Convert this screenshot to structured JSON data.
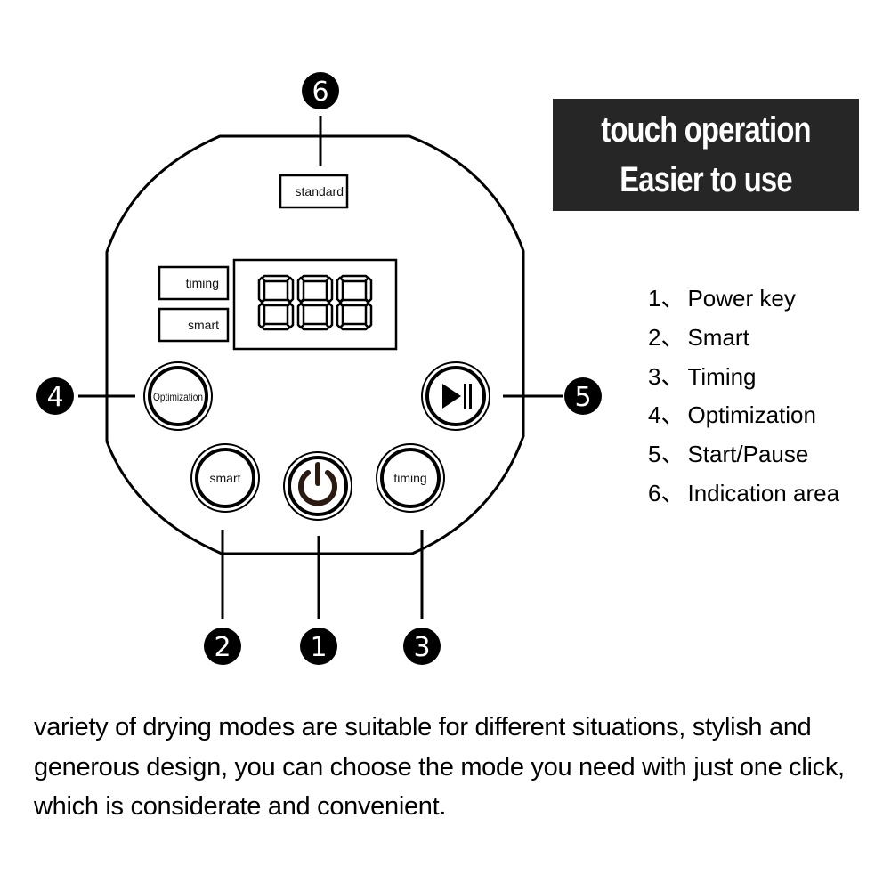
{
  "panel": {
    "indicator_standard": "standard",
    "indicator_timing": "timing",
    "indicator_smart": "smart",
    "display_digits": "888",
    "buttons": {
      "optimization": "Optimization",
      "smart": "smart",
      "timing": "timing",
      "power_icon": "power-icon",
      "start_pause_icon": "play-pause-icon"
    },
    "callouts": {
      "power": "1",
      "smart": "2",
      "timing": "3",
      "optimization": "4",
      "start_pause": "5",
      "indication": "6"
    }
  },
  "banner": {
    "line1": "touch operation",
    "line2": "Easier to use"
  },
  "legend": [
    {
      "num": "1",
      "sep": "、",
      "label": "Power key"
    },
    {
      "num": "2",
      "sep": "、",
      "label": "Smart"
    },
    {
      "num": "3",
      "sep": "、",
      "label": "Timing"
    },
    {
      "num": "4",
      "sep": "、",
      "label": "Optimization"
    },
    {
      "num": "5",
      "sep": "、",
      "label": "Start/Pause"
    },
    {
      "num": "6",
      "sep": "、",
      "label": "Indication area"
    }
  ],
  "description": "variety of drying modes are suitable for different situations, stylish and generous design, you can choose the mode you need with just one click, which is considerate and convenient.",
  "colors": {
    "line": "#000000",
    "banner_bg": "#262626",
    "banner_text": "#ffffff",
    "power_icon": "#2a1a12"
  }
}
